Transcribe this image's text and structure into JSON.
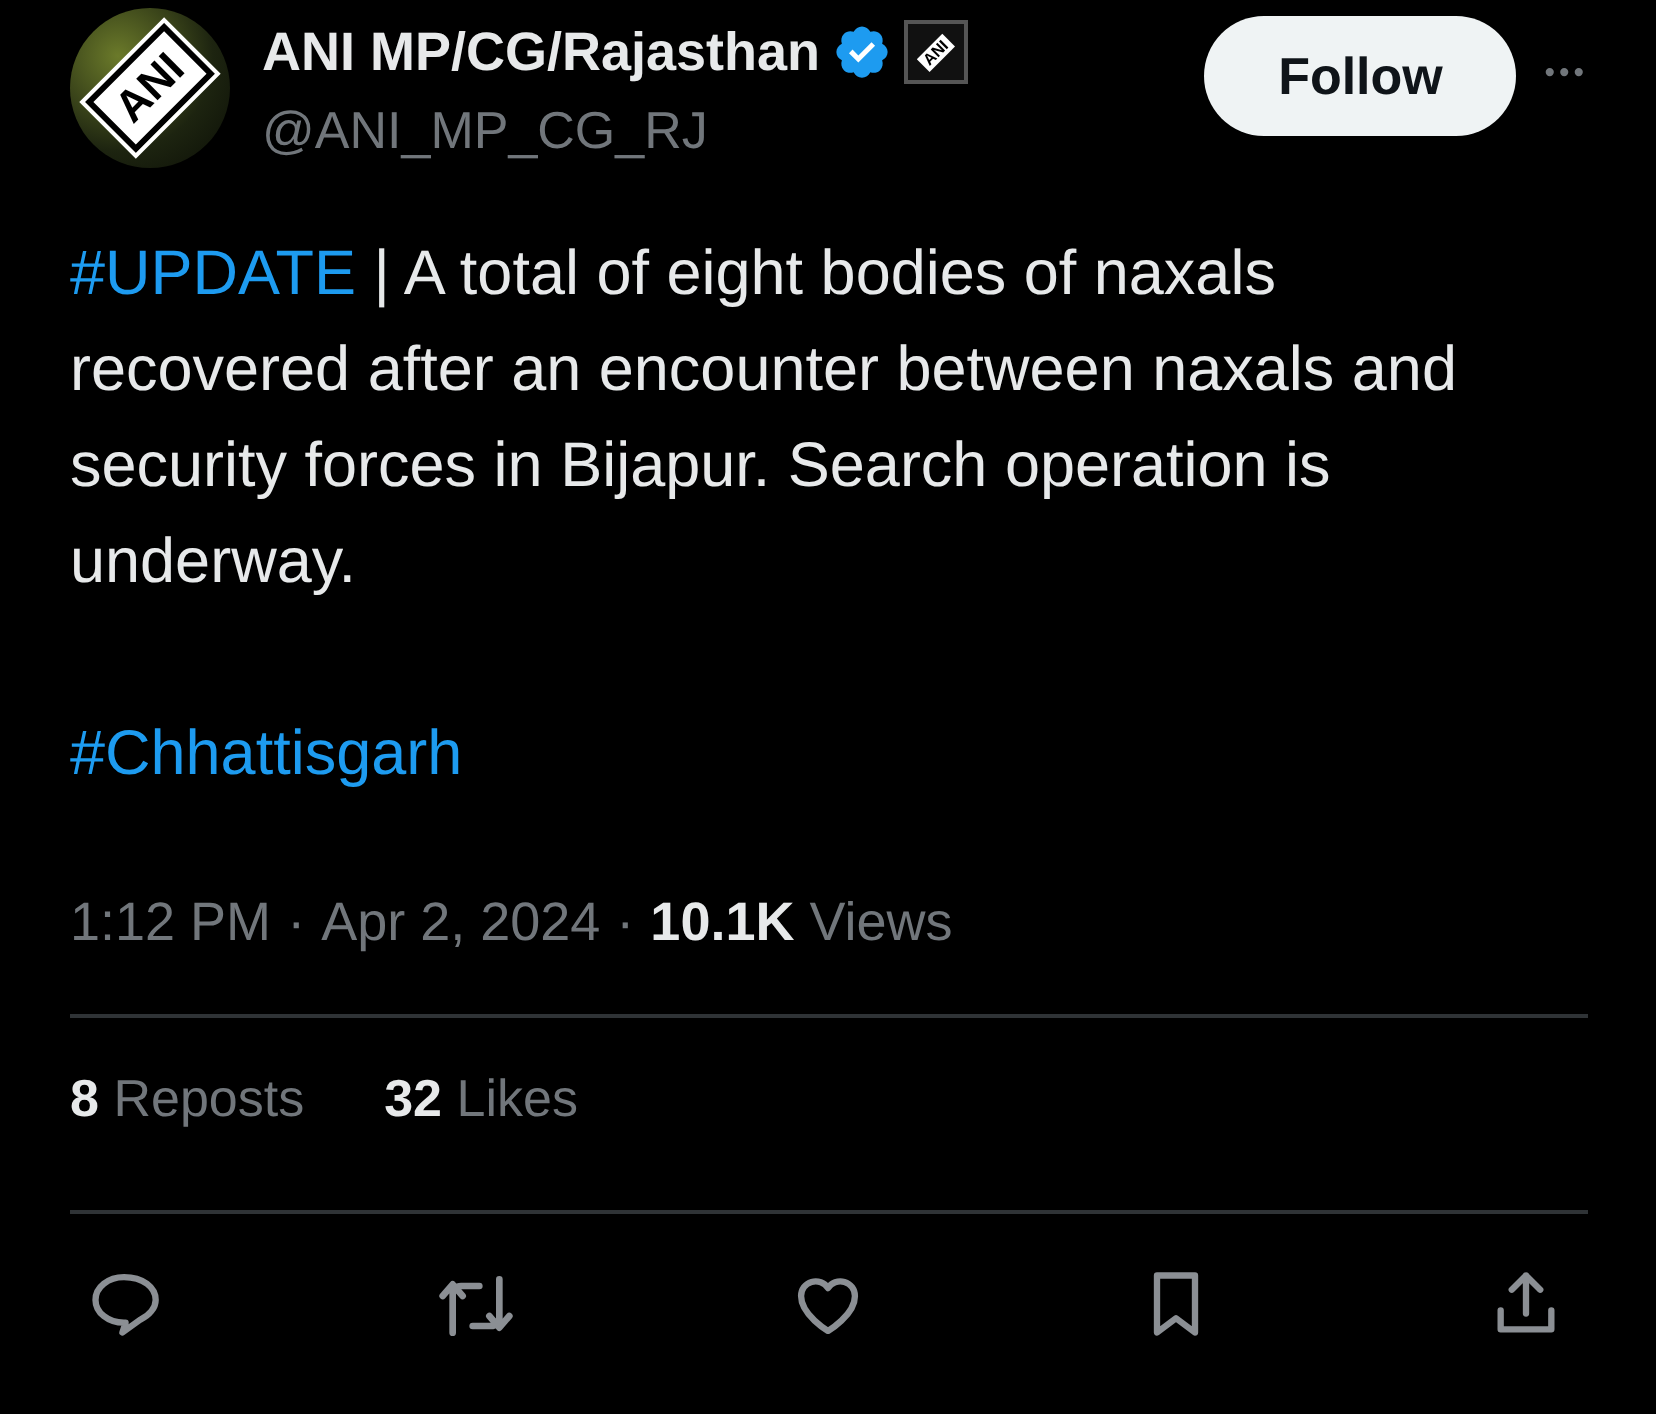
{
  "author": {
    "avatar_text": "ANI",
    "name": "ANI MP/CG/Rajasthan",
    "verified": true,
    "badge_text": "ANI",
    "handle": "@ANI_MP_CG_RJ"
  },
  "follow_button": "Follow",
  "more_button": "•••",
  "body": [
    {
      "parts": [
        {
          "kind": "hashtag",
          "text": "#UPDATE"
        },
        {
          "kind": "text",
          "text": " | A total of eight bodies of naxals recovered after an encounter between naxals and security forces in Bijapur. Search operation is underway."
        }
      ]
    },
    {
      "parts": [
        {
          "kind": "hashtag",
          "text": "#Chhattisgarh"
        }
      ]
    }
  ],
  "meta": {
    "time": "1:12 PM",
    "separator": "·",
    "date": "Apr 2, 2024",
    "views_count": "10.1K",
    "views_label": "Views"
  },
  "stats": [
    {
      "count": "8",
      "label": "Reposts"
    },
    {
      "count": "32",
      "label": "Likes"
    }
  ],
  "actions": [
    {
      "kind": "reply"
    },
    {
      "kind": "repost"
    },
    {
      "kind": "like"
    },
    {
      "kind": "bookmark"
    },
    {
      "kind": "share"
    }
  ]
}
